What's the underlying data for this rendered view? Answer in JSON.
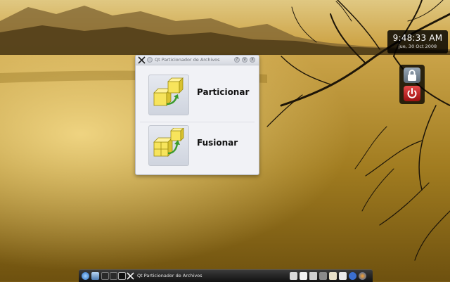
{
  "clock": {
    "time": "9:48:33 AM",
    "date": "jue, 30 Oct 2008"
  },
  "window": {
    "title": "Qt Particionador de Archivos",
    "titlebar_icons": [
      "app-icon",
      "pin-icon",
      "help-icon",
      "minimize-icon",
      "close-icon"
    ],
    "buttons": [
      {
        "label": "Particionar",
        "icon": "split-cubes-icon"
      },
      {
        "label": "Fusionar",
        "icon": "merge-cubes-icon"
      }
    ]
  },
  "session": {
    "lock_icon": "lock-icon",
    "logout_icon": "power-icon"
  },
  "taskbar": {
    "task_label": "Qt Particionador de Archivos",
    "launchers": [
      "kde-menu-icon",
      "desktop-icon",
      "pager-icon",
      "pager-icon-2",
      "terminal-icon"
    ],
    "tray": [
      "folder-icon",
      "document-icon",
      "volume-icon",
      "network-icon",
      "clipboard-icon",
      "printer-icon",
      "bluetooth-icon",
      "firefox-icon",
      "globe-icon"
    ]
  },
  "colors": {
    "sky": "#d9b050",
    "lake": "#b08a24",
    "clock_bg": "#0b0b0b",
    "power": "#c81e1e"
  }
}
